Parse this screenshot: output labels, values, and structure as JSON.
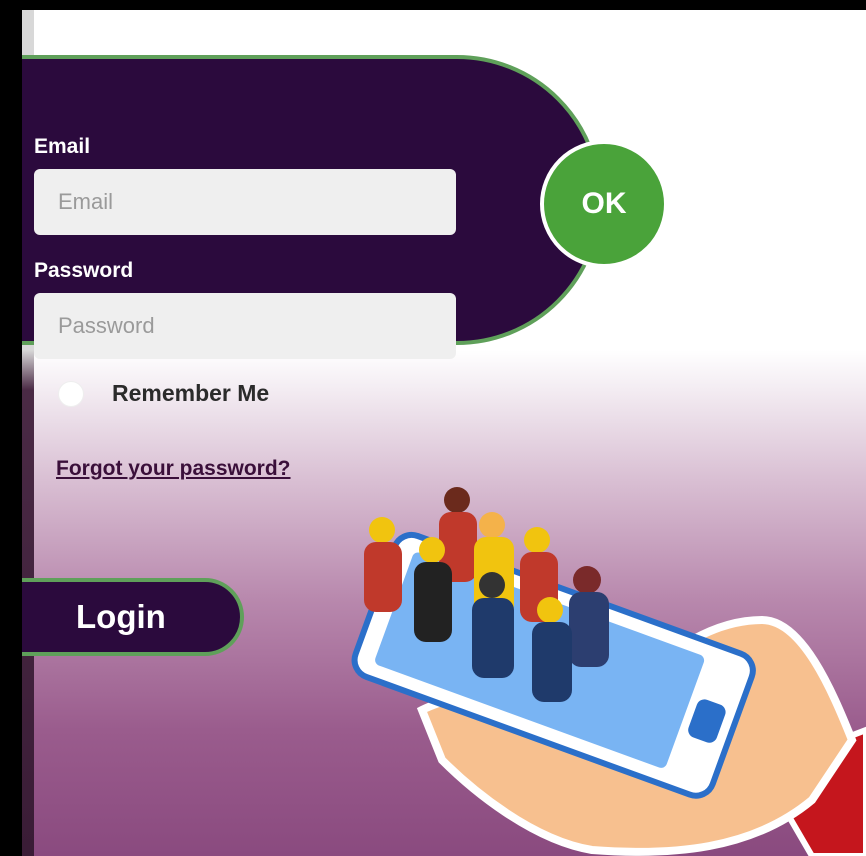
{
  "form": {
    "email_label": "Email",
    "email_placeholder": "Email",
    "email_value": "",
    "password_label": "Password",
    "password_placeholder": "Password",
    "password_value": "",
    "ok_label": "OK"
  },
  "remember": {
    "label": "Remember Me",
    "checked": false
  },
  "forgot": {
    "label": "Forgot your password?"
  },
  "login": {
    "label": "Login"
  },
  "colors": {
    "panel": "#2b0a3d",
    "accent_border": "#5fa05a",
    "ok_button": "#4aa33a"
  },
  "illustration": {
    "icon": "hand-holding-phone-with-people-illustration"
  }
}
